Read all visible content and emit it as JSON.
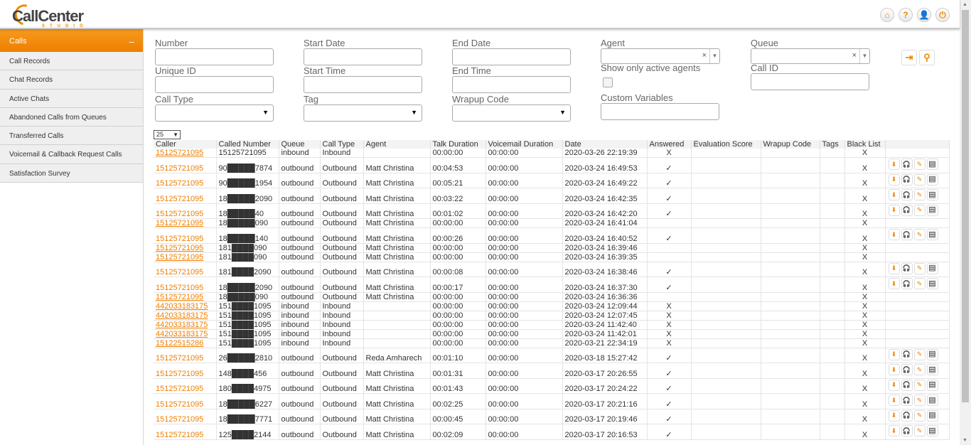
{
  "app": {
    "logo_text": "CallCenter",
    "logo_sub": "STUDIO"
  },
  "top_icons": [
    "⌂",
    "?",
    "👤",
    "⏻"
  ],
  "sidebar": {
    "header": "Calls",
    "collapse": "–",
    "items": [
      {
        "label": "Call Records"
      },
      {
        "label": "Chat Records"
      },
      {
        "label": "Active Chats"
      },
      {
        "label": "Abandoned Calls from Queues"
      },
      {
        "label": "Transferred Calls"
      },
      {
        "label": "Voicemail & Callback Request Calls"
      },
      {
        "label": "Satisfaction Survey"
      }
    ]
  },
  "filters": {
    "number": "Number",
    "start_date": "Start Date",
    "end_date": "End Date",
    "agent": "Agent",
    "queue": "Queue",
    "unique_id": "Unique ID",
    "start_time": "Start Time",
    "end_time": "End Time",
    "show_active": "Show only active agents",
    "call_id": "Call ID",
    "call_type": "Call Type",
    "tag": "Tag",
    "wrapup_code": "Wrapup Code",
    "custom_variables": "Custom Variables"
  },
  "page_size": "25",
  "columns": [
    "Caller",
    "Called Number",
    "Queue",
    "Call Type",
    "Agent",
    "Talk Duration",
    "Voicemail Duration",
    "Date",
    "Answered",
    "Evaluation Score",
    "Wrapup Code",
    "Tags",
    "Black List",
    ""
  ],
  "rows": [
    {
      "caller": "15125721095",
      "called": "15125721095",
      "queue": "inbound",
      "type": "Inbound",
      "agent": "",
      "talk": "00:00:00",
      "vm": "00:00:00",
      "date": "2020-03-26 22:19:39",
      "answered": "X",
      "bl": "X",
      "actions": false
    },
    {
      "caller": "15125721095",
      "called": "90█████7874",
      "queue": "outbound",
      "type": "Outbound",
      "agent": "Matt Christina",
      "talk": "00:04:53",
      "vm": "00:00:00",
      "date": "2020-03-24 16:49:53",
      "answered": "✓",
      "bl": "X",
      "actions": true
    },
    {
      "caller": "15125721095",
      "called": "90█████1954",
      "queue": "outbound",
      "type": "Outbound",
      "agent": "Matt Christina",
      "talk": "00:05:21",
      "vm": "00:00:00",
      "date": "2020-03-24 16:49:22",
      "answered": "✓",
      "bl": "X",
      "actions": true
    },
    {
      "caller": "15125721095",
      "called": "18█████2090",
      "queue": "outbound",
      "type": "Outbound",
      "agent": "Matt Christina",
      "talk": "00:03:22",
      "vm": "00:00:00",
      "date": "2020-03-24 16:42:35",
      "answered": "✓",
      "bl": "X",
      "actions": true
    },
    {
      "caller": "15125721095",
      "called": "18█████40",
      "queue": "outbound",
      "type": "Outbound",
      "agent": "Matt Christina",
      "talk": "00:01:02",
      "vm": "00:00:00",
      "date": "2020-03-24 16:42:20",
      "answered": "✓",
      "bl": "X",
      "actions": true
    },
    {
      "caller": "15125721095",
      "called": "18█████090",
      "queue": "outbound",
      "type": "Outbound",
      "agent": "Matt Christina",
      "talk": "00:00:00",
      "vm": "00:00:00",
      "date": "2020-03-24 16:41:04",
      "answered": "",
      "bl": "X",
      "actions": false
    },
    {
      "caller": "15125721095",
      "called": "18█████140",
      "queue": "outbound",
      "type": "Outbound",
      "agent": "Matt Christina",
      "talk": "00:00:26",
      "vm": "00:00:00",
      "date": "2020-03-24 16:40:52",
      "answered": "✓",
      "bl": "X",
      "actions": true
    },
    {
      "caller": "15125721095",
      "called": "181████090",
      "queue": "outbound",
      "type": "Outbound",
      "agent": "Matt Christina",
      "talk": "00:00:00",
      "vm": "00:00:00",
      "date": "2020-03-24 16:39:46",
      "answered": "",
      "bl": "X",
      "actions": false
    },
    {
      "caller": "15125721095",
      "called": "181████090",
      "queue": "outbound",
      "type": "Outbound",
      "agent": "Matt Christina",
      "talk": "00:00:00",
      "vm": "00:00:00",
      "date": "2020-03-24 16:39:35",
      "answered": "",
      "bl": "X",
      "actions": false
    },
    {
      "caller": "15125721095",
      "called": "181████2090",
      "queue": "outbound",
      "type": "Outbound",
      "agent": "Matt Christina",
      "talk": "00:00:08",
      "vm": "00:00:00",
      "date": "2020-03-24 16:38:46",
      "answered": "✓",
      "bl": "X",
      "actions": true
    },
    {
      "caller": "15125721095",
      "called": "18█████2090",
      "queue": "outbound",
      "type": "Outbound",
      "agent": "Matt Christina",
      "talk": "00:00:17",
      "vm": "00:00:00",
      "date": "2020-03-24 16:37:30",
      "answered": "✓",
      "bl": "X",
      "actions": true
    },
    {
      "caller": "15125721095",
      "called": "18█████090",
      "queue": "outbound",
      "type": "Outbound",
      "agent": "Matt Christina",
      "talk": "00:00:00",
      "vm": "00:00:00",
      "date": "2020-03-24 16:36:36",
      "answered": "",
      "bl": "X",
      "actions": false
    },
    {
      "caller": "442033183175",
      "called": "151████1095",
      "queue": "inbound",
      "type": "Inbound",
      "agent": "",
      "talk": "00:00:00",
      "vm": "00:00:00",
      "date": "2020-03-24 12:09:44",
      "answered": "X",
      "bl": "X",
      "actions": false
    },
    {
      "caller": "442033183175",
      "called": "151████1095",
      "queue": "inbound",
      "type": "Inbound",
      "agent": "",
      "talk": "00:00:00",
      "vm": "00:00:00",
      "date": "2020-03-24 12:07:45",
      "answered": "X",
      "bl": "X",
      "actions": false
    },
    {
      "caller": "442033183175",
      "called": "151████1095",
      "queue": "inbound",
      "type": "Inbound",
      "agent": "",
      "talk": "00:00:00",
      "vm": "00:00:00",
      "date": "2020-03-24 11:42:40",
      "answered": "X",
      "bl": "X",
      "actions": false
    },
    {
      "caller": "442033183175",
      "called": "151████1095",
      "queue": "inbound",
      "type": "Inbound",
      "agent": "",
      "talk": "00:00:00",
      "vm": "00:00:00",
      "date": "2020-03-24 11:42:01",
      "answered": "X",
      "bl": "X",
      "actions": false
    },
    {
      "caller": "15122515286",
      "called": "151████1095",
      "queue": "inbound",
      "type": "Inbound",
      "agent": "",
      "talk": "00:00:00",
      "vm": "00:00:00",
      "date": "2020-03-21 22:34:19",
      "answered": "X",
      "bl": "X",
      "actions": false
    },
    {
      "caller": "15125721095",
      "called": "26█████2810",
      "queue": "outbound",
      "type": "Outbound",
      "agent": "Reda Amharech",
      "talk": "00:01:10",
      "vm": "00:00:00",
      "date": "2020-03-18 15:27:42",
      "answered": "✓",
      "bl": "X",
      "actions": true
    },
    {
      "caller": "15125721095",
      "called": "148████456",
      "queue": "outbound",
      "type": "Outbound",
      "agent": "Matt Christina",
      "talk": "00:01:31",
      "vm": "00:00:00",
      "date": "2020-03-17 20:26:55",
      "answered": "✓",
      "bl": "X",
      "actions": true
    },
    {
      "caller": "15125721095",
      "called": "180████4975",
      "queue": "outbound",
      "type": "Outbound",
      "agent": "Matt Christina",
      "talk": "00:01:43",
      "vm": "00:00:00",
      "date": "2020-03-17 20:24:22",
      "answered": "✓",
      "bl": "X",
      "actions": true
    },
    {
      "caller": "15125721095",
      "called": "18█████6227",
      "queue": "outbound",
      "type": "Outbound",
      "agent": "Matt Christina",
      "talk": "00:02:25",
      "vm": "00:00:00",
      "date": "2020-03-17 20:21:16",
      "answered": "✓",
      "bl": "X",
      "actions": true
    },
    {
      "caller": "15125721095",
      "called": "18█████7771",
      "queue": "outbound",
      "type": "Outbound",
      "agent": "Matt Christina",
      "talk": "00:00:45",
      "vm": "00:00:00",
      "date": "2020-03-17 20:19:46",
      "answered": "✓",
      "bl": "X",
      "actions": true
    },
    {
      "caller": "15125721095",
      "called": "125████2144",
      "queue": "outbound",
      "type": "Outbound",
      "agent": "Matt Christina",
      "talk": "00:02:09",
      "vm": "00:00:00",
      "date": "2020-03-17 20:16:53",
      "answered": "✓",
      "bl": "X",
      "actions": true
    }
  ]
}
